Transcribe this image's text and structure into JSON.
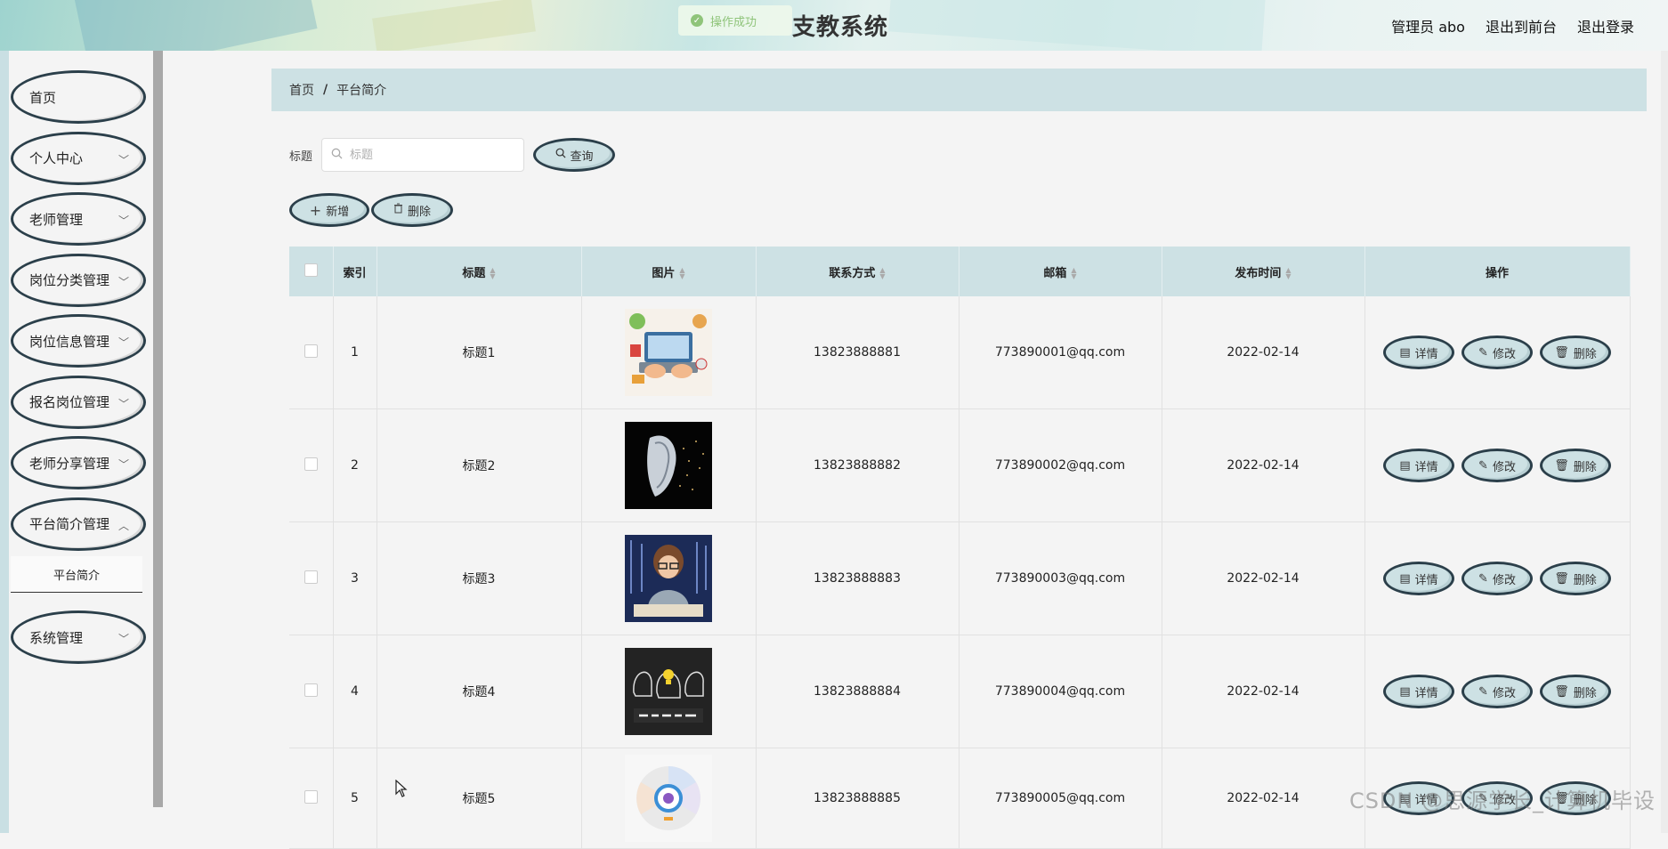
{
  "header": {
    "toast": "操作成功",
    "title": "支教系统",
    "user": "管理员 abo",
    "to_front": "退出到前台",
    "logout": "退出登录"
  },
  "sidebar": {
    "items": [
      {
        "label": "首页"
      },
      {
        "label": "个人中心"
      },
      {
        "label": "老师管理"
      },
      {
        "label": "岗位分类管理"
      },
      {
        "label": "岗位信息管理"
      },
      {
        "label": "报名岗位管理"
      },
      {
        "label": "老师分享管理"
      },
      {
        "label": "平台简介管理"
      },
      {
        "label": "系统管理"
      }
    ],
    "submenu_active": "平台简介"
  },
  "breadcrumb": {
    "home": "首页",
    "sep": "/",
    "current": "平台简介"
  },
  "search": {
    "label": "标题",
    "placeholder": "标题",
    "query_button": "查询"
  },
  "actions": {
    "add": "新增",
    "delete": "删除"
  },
  "table": {
    "headers": [
      "索引",
      "标题",
      "图片",
      "联系方式",
      "邮箱",
      "发布时间",
      "操作"
    ],
    "row_actions": {
      "detail": "详情",
      "edit": "修改",
      "delete": "删除"
    },
    "rows": [
      {
        "index": "1",
        "title": "标题1",
        "phone": "13823888881",
        "email": "773890001@qq.com",
        "date": "2022-02-14",
        "image": "laptop-illustration"
      },
      {
        "index": "2",
        "title": "标题2",
        "phone": "13823888882",
        "email": "773890002@qq.com",
        "date": "2022-02-14",
        "image": "ai-face"
      },
      {
        "index": "3",
        "title": "标题3",
        "phone": "13823888883",
        "email": "773890003@qq.com",
        "date": "2022-02-14",
        "image": "child-keyboard"
      },
      {
        "index": "4",
        "title": "标题4",
        "phone": "13823888884",
        "email": "773890004@qq.com",
        "date": "2022-02-14",
        "image": "education-chalkboard"
      },
      {
        "index": "5",
        "title": "标题5",
        "phone": "13823888885",
        "email": "773890005@qq.com",
        "date": "2022-02-14",
        "image": "circular-infographic"
      }
    ]
  },
  "watermark": "CSDN @思源学长_计算机毕设"
}
